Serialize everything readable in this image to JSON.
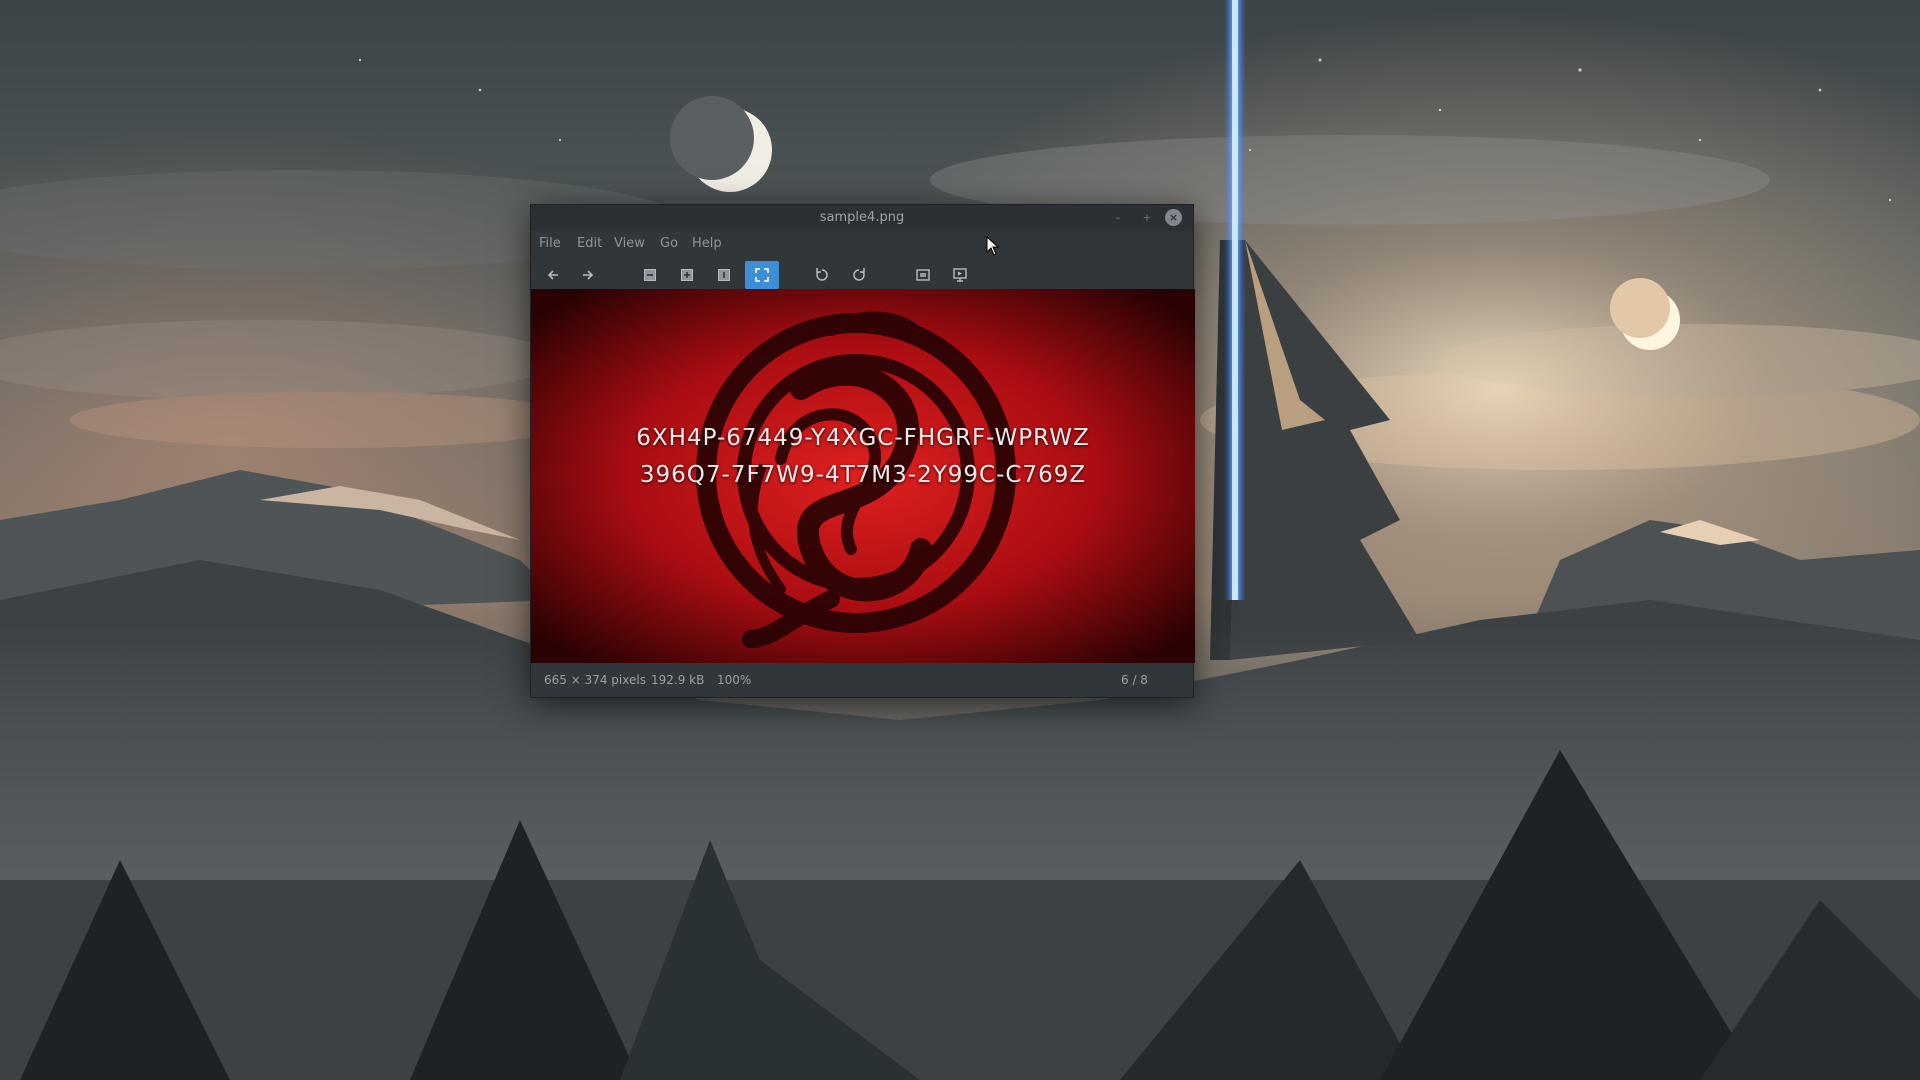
{
  "window": {
    "title": "sample4.png",
    "controls": {
      "minimize": "–",
      "maximize": "+",
      "close": "×"
    }
  },
  "menu": [
    "File",
    "Edit",
    "View",
    "Go",
    "Help"
  ],
  "toolbar": {
    "buttons": [
      "back-arrow-icon",
      "forward-arrow-icon",
      "zoom-out-icon",
      "zoom-in-icon",
      "zoom-original-icon",
      "zoom-fit-icon",
      "rotate-left-icon",
      "rotate-right-icon",
      "fullscreen-icon",
      "slideshow-icon"
    ],
    "active": "zoom-fit-icon"
  },
  "image": {
    "lines": [
      "6XH4P-67449-Y4XGC-FHGRF-WPRWZ",
      "396Q7-7F7W9-4T7M3-2Y99C-C769Z"
    ]
  },
  "status": {
    "dimensions": "665 × 374 pixels",
    "size": "192.9 kB",
    "zoom": "100%",
    "position": "6 / 8"
  },
  "colors": {
    "accent": "#3d8ed6",
    "window_bg": "#31363b",
    "image_red": "#c4141b"
  }
}
